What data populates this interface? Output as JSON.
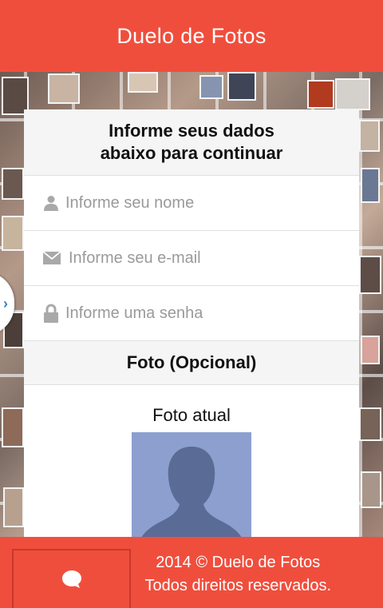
{
  "header": {
    "title": "Duelo de Fotos"
  },
  "form": {
    "title_line1": "Informe seus dados",
    "title_line2": "abaixo para continuar",
    "name_placeholder": "Informe seu nome",
    "email_placeholder": "Informe seu e-mail",
    "password_placeholder": "Informe uma senha"
  },
  "photo": {
    "section_title": "Foto (Opcional)",
    "current_label": "Foto atual"
  },
  "footer": {
    "copyright": "2014 © Duelo de Fotos",
    "rights": "Todos direitos reservados."
  },
  "icons": {
    "name": "user-icon",
    "email": "envelope-icon",
    "password": "lock-icon",
    "side_tab": "chevron-right-icon",
    "chat": "chat-bubble-icon"
  },
  "colors": {
    "brand": "#f04e3d",
    "icon_gray": "#a9a9a9",
    "avatar_bg": "#8c9fcf"
  }
}
